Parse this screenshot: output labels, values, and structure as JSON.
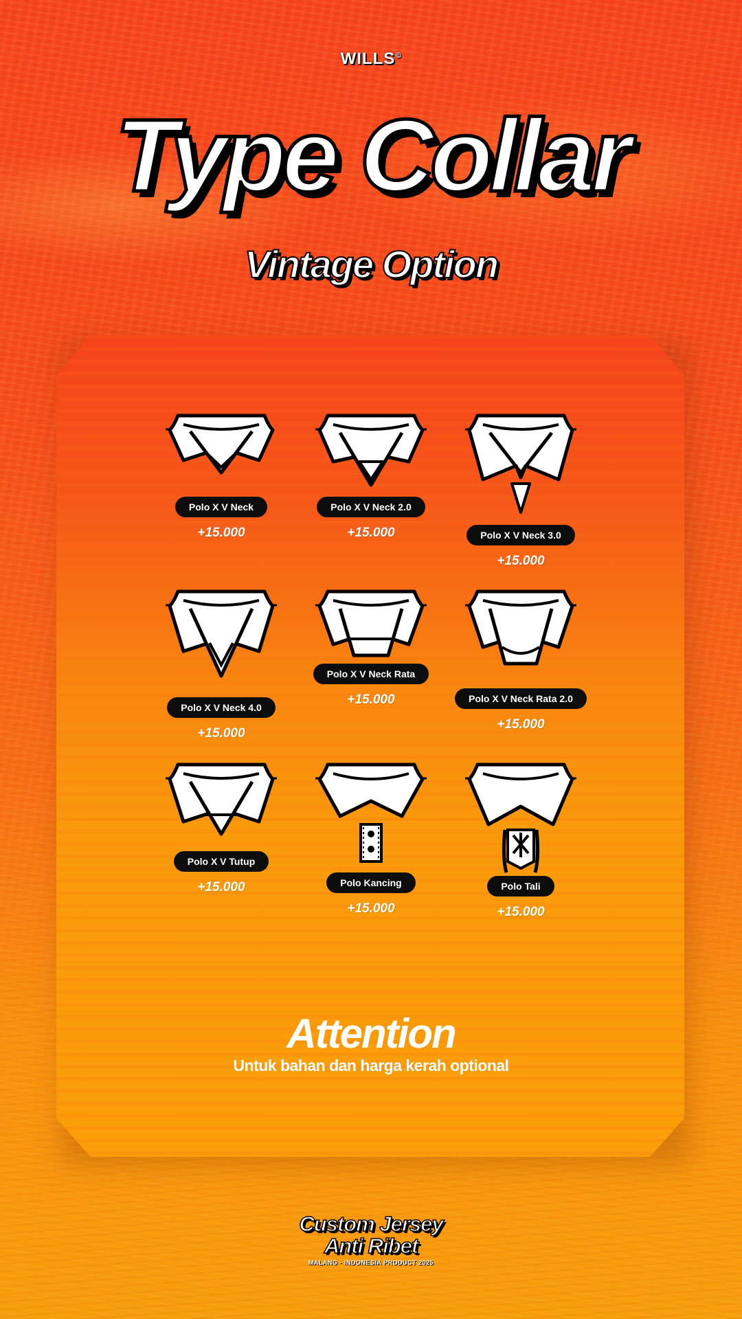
{
  "brand": {
    "name": "WILLS",
    "mark": "©"
  },
  "header": {
    "title": "Type Collar",
    "subtitle": "Vintage Option"
  },
  "collars": [
    {
      "label": "Polo X V Neck",
      "price": "+15.000",
      "icon": "polo-v-neck-collar-icon"
    },
    {
      "label": "Polo X V Neck 2.0",
      "price": "+15.000",
      "icon": "polo-v-neck-2-collar-icon"
    },
    {
      "label": "Polo X V Neck 3.0",
      "price": "+15.000",
      "icon": "polo-v-neck-3-collar-icon"
    },
    {
      "label": "Polo X V Neck 4.0",
      "price": "+15.000",
      "icon": "polo-v-neck-4-collar-icon"
    },
    {
      "label": "Polo X V Neck Rata",
      "price": "+15.000",
      "icon": "polo-v-neck-rata-collar-icon"
    },
    {
      "label": "Polo X V Neck Rata 2.0",
      "price": "+15.000",
      "icon": "polo-v-neck-rata-2-collar-icon"
    },
    {
      "label": "Polo X V Tutup",
      "price": "+15.000",
      "icon": "polo-v-tutup-collar-icon"
    },
    {
      "label": "Polo Kancing",
      "price": "+15.000",
      "icon": "polo-kancing-collar-icon"
    },
    {
      "label": "Polo Tali",
      "price": "+15.000",
      "icon": "polo-tali-collar-icon"
    }
  ],
  "notice": {
    "title": "Attention",
    "text": "Untuk bahan dan harga kerah optional"
  },
  "footer": {
    "line1": "Custom Jersey",
    "line2": "Anti Ribet",
    "tagline": "MALANG - INDONESIA PRODUCT 2025"
  },
  "colors": {
    "primary": "#f5401f",
    "secondary": "#f99a0b",
    "ink": "#0d0d0d",
    "paper": "#ffffff"
  }
}
